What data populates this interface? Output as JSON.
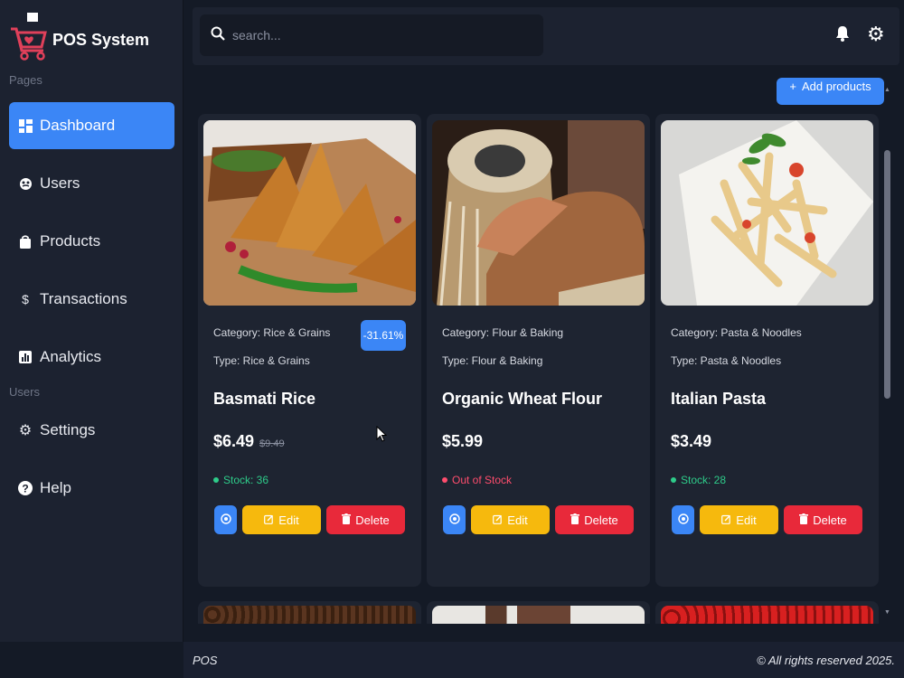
{
  "app": {
    "title": "POS System"
  },
  "sidebar": {
    "sections": [
      {
        "label": "Pages"
      },
      {
        "label": "Users"
      }
    ],
    "items": [
      {
        "label": "Dashboard",
        "icon": "dashboard-icon",
        "active": true
      },
      {
        "label": "Users",
        "icon": "users-icon",
        "active": false
      },
      {
        "label": "Products",
        "icon": "bag-icon",
        "active": false
      },
      {
        "label": "Transactions",
        "icon": "dollar-icon",
        "active": false
      },
      {
        "label": "Analytics",
        "icon": "chart-icon",
        "active": false
      },
      {
        "label": "Settings",
        "icon": "gear-icon",
        "active": false
      },
      {
        "label": "Help",
        "icon": "question-icon",
        "active": false
      }
    ]
  },
  "topbar": {
    "search_placeholder": "search...",
    "icons": [
      "bell-icon",
      "gear-icon"
    ]
  },
  "main": {
    "add_button_label": "Add products",
    "products": [
      {
        "category": "Category: Rice & Grains",
        "type": "Type: Rice & Grains",
        "name": "Basmati Rice",
        "price": "$6.49",
        "old_price": "$9.49",
        "discount": "-31.61%",
        "stock": "Stock: 36",
        "stock_status": "in",
        "image": "samosa-photo"
      },
      {
        "category": "Category: Flour & Baking",
        "type": "Type: Flour & Baking",
        "name": "Organic Wheat Flour",
        "price": "$5.99",
        "old_price": "",
        "discount": "",
        "stock": "Out of Stock",
        "stock_status": "out",
        "image": "tabla-drum-photo"
      },
      {
        "category": "Category: Pasta & Noodles",
        "type": "Type: Pasta & Noodles",
        "name": "Italian Pasta",
        "price": "$3.49",
        "old_price": "",
        "discount": "",
        "stock": "Stock: 28",
        "stock_status": "in",
        "image": "penne-pasta-photo"
      }
    ],
    "buttons": {
      "edit": "Edit",
      "delete": "Delete"
    }
  },
  "colors": {
    "accent": "#3b86f6",
    "edit": "#f6b90d",
    "delete": "#e8293a",
    "in_stock": "#2ecc8a",
    "out_of_stock": "#ff4d6d"
  },
  "footer": {
    "left": "POS",
    "right": "© All rights reserved 2025."
  }
}
